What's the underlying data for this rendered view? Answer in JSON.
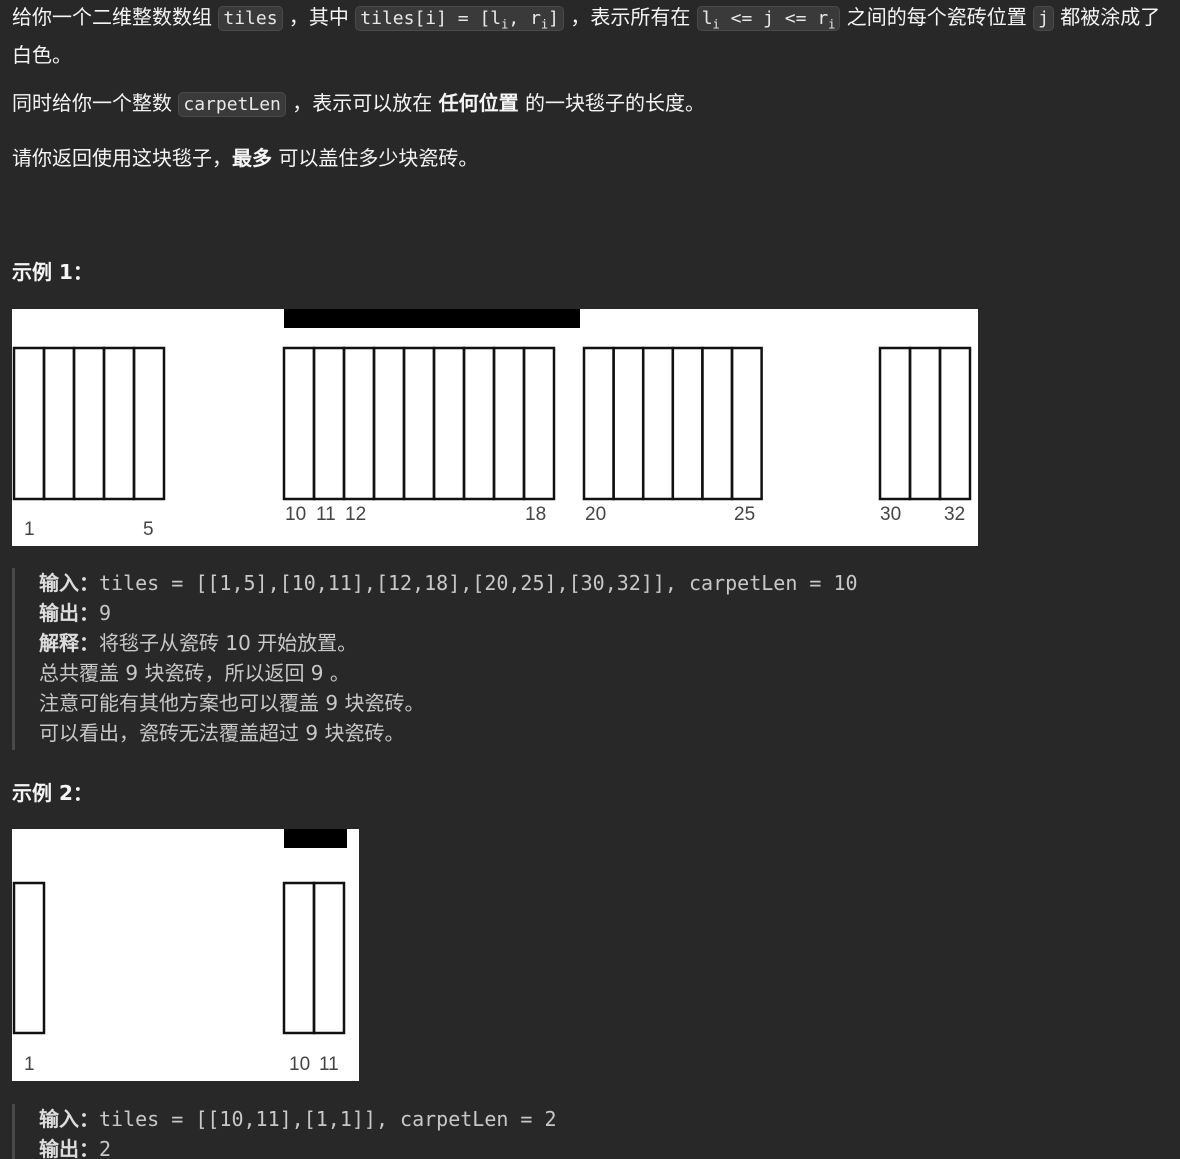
{
  "description": {
    "p1_a": "给你一个二维整数数组 ",
    "p1_code1": "tiles",
    "p1_b": " ，其中 ",
    "p1_code2_a": "tiles[i] = [l",
    "p1_code2_sub1": "i",
    "p1_code2_b": ", r",
    "p1_code2_sub2": "i",
    "p1_code2_c": "]",
    "p1_c": " ，表示所有在 ",
    "p1_code3_a": "l",
    "p1_code3_sub1": "i",
    "p1_code3_b": " <= j <= r",
    "p1_code3_sub2": "i",
    "p1_d": " 之间的每个瓷砖位置 ",
    "p1_code4": "j",
    "p1_e": " 都被涂成了白色。",
    "p2_a": "同时给你一个整数 ",
    "p2_code": "carpetLen",
    "p2_b": " ，表示可以放在 ",
    "p2_bold": "任何位置",
    "p2_c": " 的一块毯子的长度。",
    "p3_a": "请你返回使用这块毯子，",
    "p3_bold": "最多",
    "p3_b": " 可以盖住多少块瓷砖。"
  },
  "example1": {
    "heading": "示例 1：",
    "figure_labels": [
      "1",
      "5",
      "10",
      "11",
      "12",
      "18",
      "20",
      "25",
      "30",
      "32"
    ],
    "input_label": "输入：",
    "input": "tiles = [[1,5],[10,11],[12,18],[20,25],[30,32]], carpetLen = 10",
    "output_label": "输出：",
    "output": "9",
    "explain_label": "解释：",
    "explain_lines": [
      "将毯子从瓷砖 10 开始放置。",
      "总共覆盖 9 块瓷砖，所以返回 9 。",
      "注意可能有其他方案也可以覆盖 9 块瓷砖。",
      "可以看出，瓷砖无法覆盖超过 9 块瓷砖。"
    ]
  },
  "example2": {
    "heading": "示例 2：",
    "figure_labels": [
      "1",
      "10",
      "11"
    ],
    "input_label": "输入：",
    "input": "tiles = [[10,11],[1,1]], carpetLen = 2",
    "output_label": "输出：",
    "output": "2"
  }
}
